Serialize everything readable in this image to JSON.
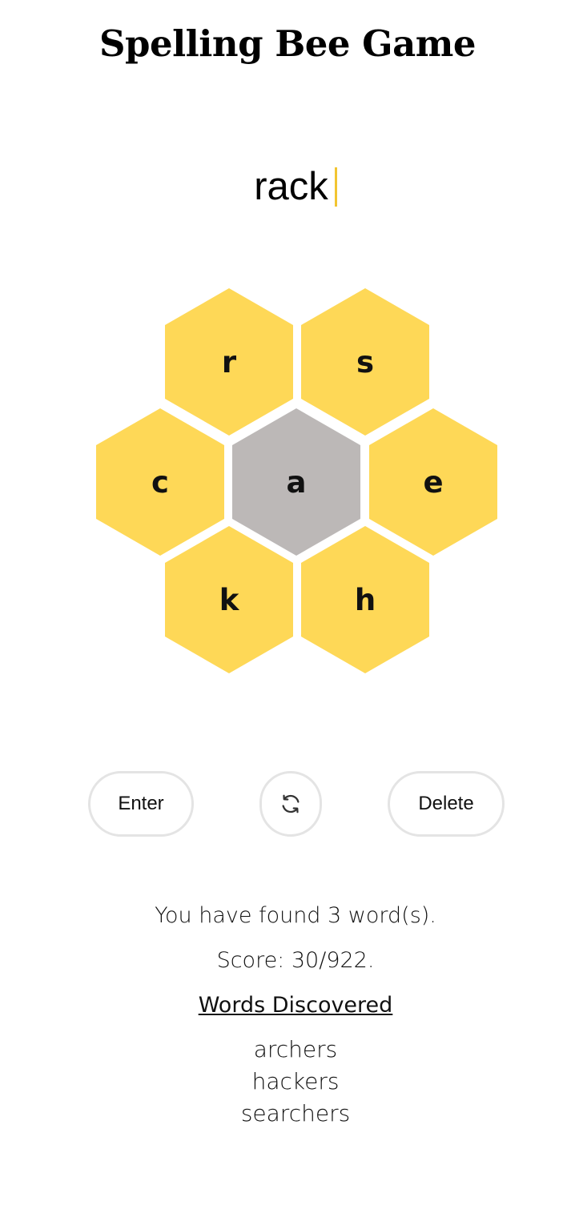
{
  "title": "Spelling Bee Game",
  "current_input": "rack",
  "hive": {
    "center_letter": "a",
    "outer_letters": [
      "r",
      "s",
      "c",
      "e",
      "k",
      "h"
    ],
    "colors": {
      "outer": "#fed857",
      "center": "#bcb8b7",
      "caret": "#f2c531"
    }
  },
  "buttons": {
    "enter_label": "Enter",
    "shuffle_icon": "refresh-icon",
    "delete_label": "Delete"
  },
  "stats": {
    "found_text": "You have found 3 word(s).",
    "score_text": "Score: 30/922."
  },
  "words_discovered": {
    "heading": "Words Discovered",
    "words": [
      "archers",
      "hackers",
      "searchers"
    ]
  }
}
